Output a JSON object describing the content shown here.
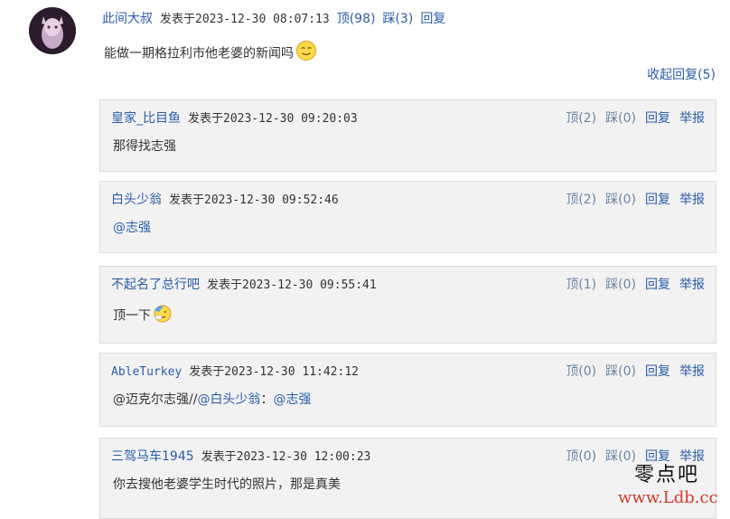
{
  "main_comment": {
    "user": "此间大叔",
    "meta": "发表于2023-12-30 08:07:13",
    "up": "顶(98)",
    "down": "踩(3)",
    "reply": "回复",
    "text": "能做一期格拉利市他老婆的新闻吗"
  },
  "collapse_label": "收起回复(5)",
  "replies": [
    {
      "user": "皇家_比目鱼",
      "meta": "发表于2023-12-30 09:20:03",
      "up": "顶(2)",
      "down": "踩(0)",
      "reply": "回复",
      "report": "举报",
      "text": "那得找志强"
    },
    {
      "user": "白头少翁",
      "meta": "发表于2023-12-30 09:52:46",
      "up": "顶(2)",
      "down": "踩(0)",
      "reply": "回复",
      "report": "举报",
      "mention": "@志强"
    },
    {
      "user": "不起名了总行吧",
      "meta": "发表于2023-12-30 09:55:41",
      "up": "顶(1)",
      "down": "踩(0)",
      "reply": "回复",
      "report": "举报",
      "text": "顶一下"
    },
    {
      "user": "AbleTurkey",
      "meta": "发表于2023-12-30 11:42:12",
      "up": "顶(0)",
      "down": "踩(0)",
      "reply": "回复",
      "report": "举报",
      "text_a": "@迈克尔志强//",
      "mention_a": "@白头少翁",
      "text_b": "：",
      "mention_b": "@志强"
    },
    {
      "user": "三驾马车1945",
      "meta": "发表于2023-12-30 12:00:23",
      "up": "顶(0)",
      "down": "踩(0)",
      "reply": "回复",
      "report": "举报",
      "text": "你去搜他老婆学生时代的照片，那是真美"
    }
  ],
  "watermark": {
    "line1": "零点吧",
    "line2": "www.Ldb.cc"
  }
}
